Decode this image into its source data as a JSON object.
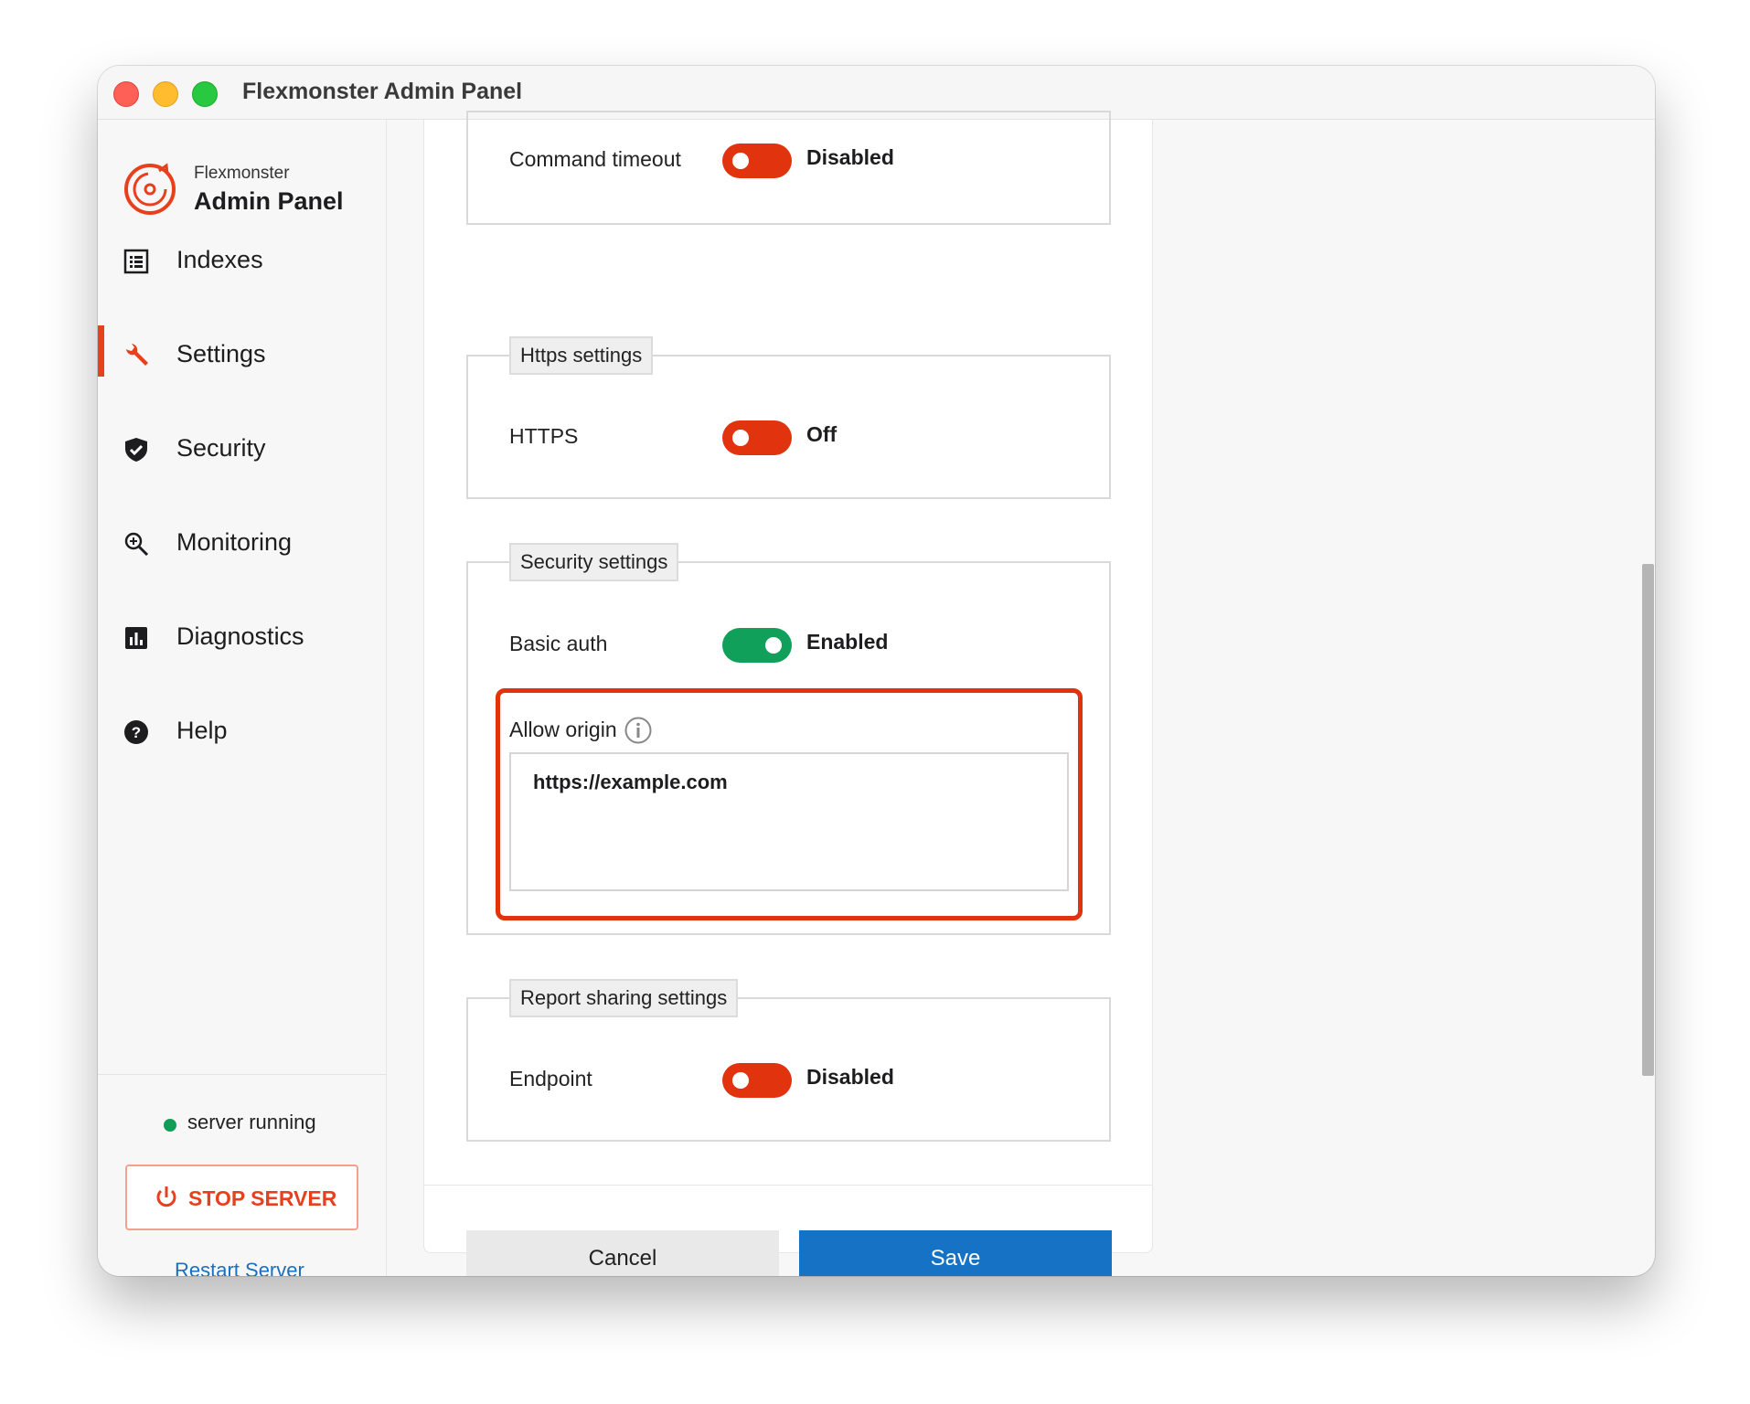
{
  "window": {
    "title": "Flexmonster Admin Panel"
  },
  "sidebar": {
    "brand_small": "Flexmonster",
    "brand_big": "Admin Panel",
    "items": [
      {
        "label": "Indexes",
        "icon": "list-icon",
        "active": false
      },
      {
        "label": "Settings",
        "icon": "wrench-icon",
        "active": true
      },
      {
        "label": "Security",
        "icon": "shield-icon",
        "active": false
      },
      {
        "label": "Monitoring",
        "icon": "magnifier-icon",
        "active": false
      },
      {
        "label": "Diagnostics",
        "icon": "bar-chart-icon",
        "active": false
      },
      {
        "label": "Help",
        "icon": "help-icon",
        "active": false
      }
    ],
    "status": "server running",
    "stop_button": "STOP SERVER",
    "restart_link": "Restart Server"
  },
  "settings": {
    "command_timeout": {
      "label": "Command timeout",
      "state": "Disabled",
      "enabled": false
    },
    "https": {
      "legend": "Https settings",
      "label": "HTTPS",
      "state": "Off",
      "enabled": false
    },
    "security": {
      "legend": "Security settings",
      "basic_auth": {
        "label": "Basic auth",
        "state": "Enabled",
        "enabled": true
      },
      "allow_origin": {
        "label": "Allow origin",
        "value": "https://example.com"
      }
    },
    "report_sharing": {
      "legend": "Report sharing settings",
      "label": "Endpoint",
      "state": "Disabled",
      "enabled": false
    }
  },
  "footer": {
    "cancel": "Cancel",
    "save": "Save"
  },
  "colors": {
    "accent": "#e8401c",
    "toggle_off": "#e2330f",
    "toggle_on": "#11a05a",
    "save_button": "#1672c4",
    "status_running": "#0f9d58"
  }
}
